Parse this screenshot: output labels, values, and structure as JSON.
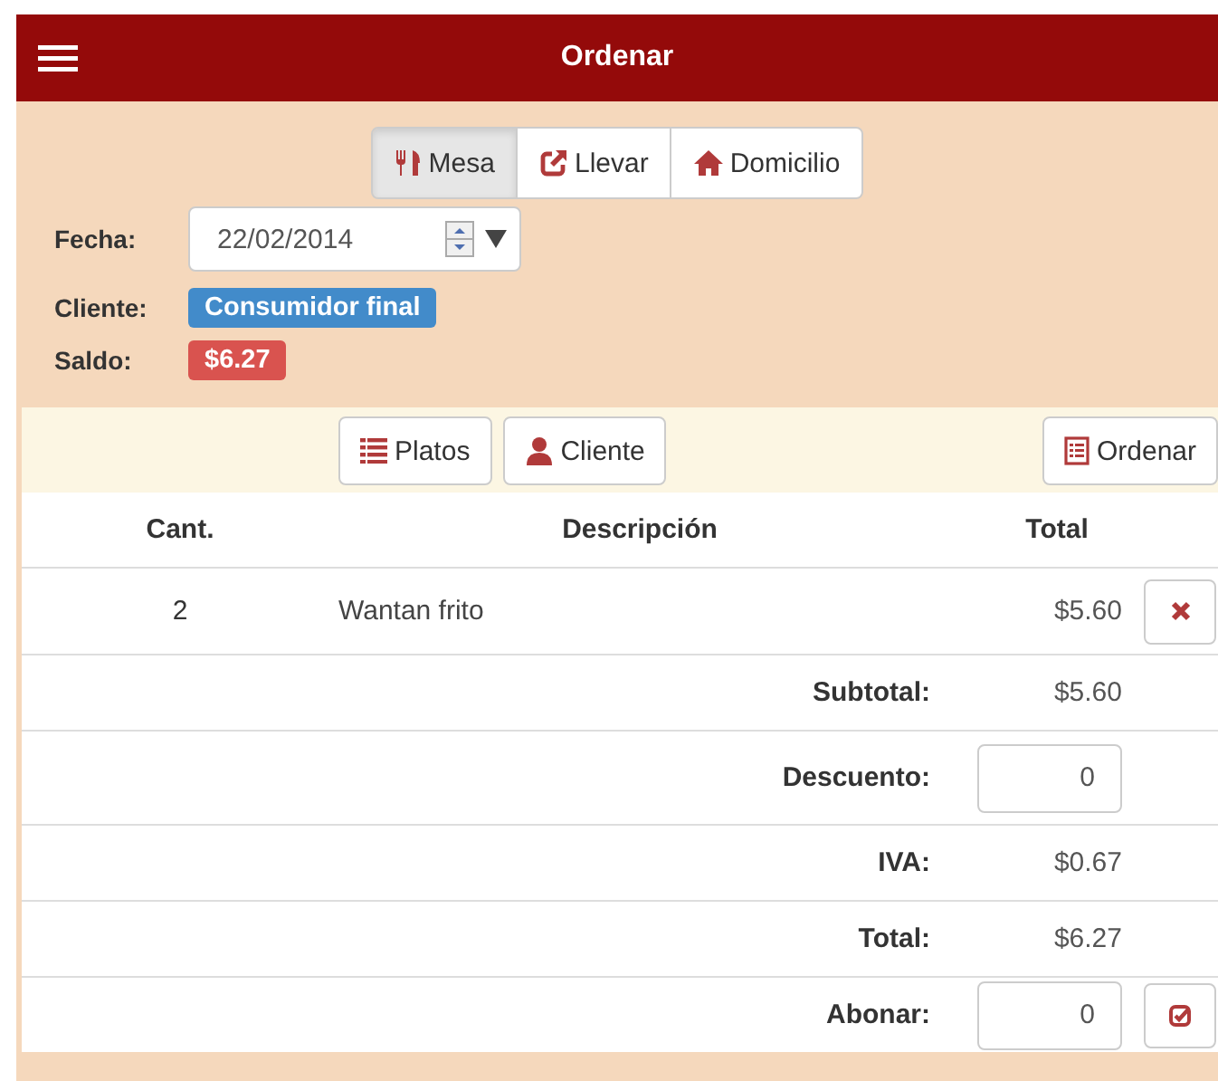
{
  "header": {
    "title": "Ordenar"
  },
  "order_types": [
    {
      "label": "Mesa",
      "selected": true
    },
    {
      "label": "Llevar",
      "selected": false
    },
    {
      "label": "Domicilio",
      "selected": false
    }
  ],
  "fecha": {
    "label": "Fecha:",
    "value": "22/02/2014"
  },
  "cliente": {
    "label": "Cliente:",
    "value": "Consumidor final"
  },
  "saldo": {
    "label": "Saldo:",
    "value": "$6.27"
  },
  "toolbar": [
    "Platos",
    "Cliente",
    "Ordenar"
  ],
  "table": {
    "columns": [
      "Cant.",
      "Descripción",
      "Total"
    ],
    "rows": [
      {
        "qty": "2",
        "description": "Wantan frito",
        "total": "$5.60"
      }
    ]
  },
  "summary": [
    {
      "kind": "text",
      "label": "Subtotal:",
      "value": "$5.60"
    },
    {
      "kind": "input",
      "label": "Descuento:",
      "value": "0"
    },
    {
      "kind": "text",
      "label": "IVA:",
      "value": "$0.67"
    },
    {
      "kind": "text",
      "label": "Total:",
      "value": "$6.27"
    },
    {
      "kind": "input-action",
      "label": "Abonar:",
      "value": "0"
    }
  ]
}
